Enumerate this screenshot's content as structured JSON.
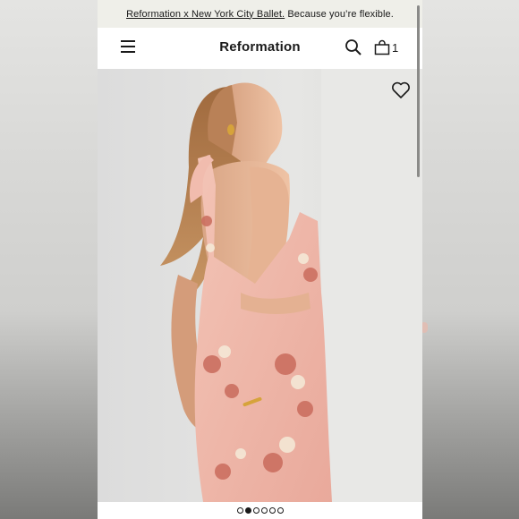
{
  "promo": {
    "link_text": "Reformation x New York City Ballet.",
    "tagline": " Because you’re flexible."
  },
  "header": {
    "brand": "Reformation",
    "bag_count": "1",
    "menu_icon": "hamburger-menu-icon",
    "search_icon": "search-icon",
    "bag_icon": "shopping-bag-icon"
  },
  "product": {
    "wishlist_icon": "heart-icon"
  },
  "carousel": {
    "total": 6,
    "active_index": 1
  },
  "colors": {
    "promo_bg": "#efefe9",
    "text": "#1a1a1a",
    "dress_pink": "#f0b3a6"
  }
}
